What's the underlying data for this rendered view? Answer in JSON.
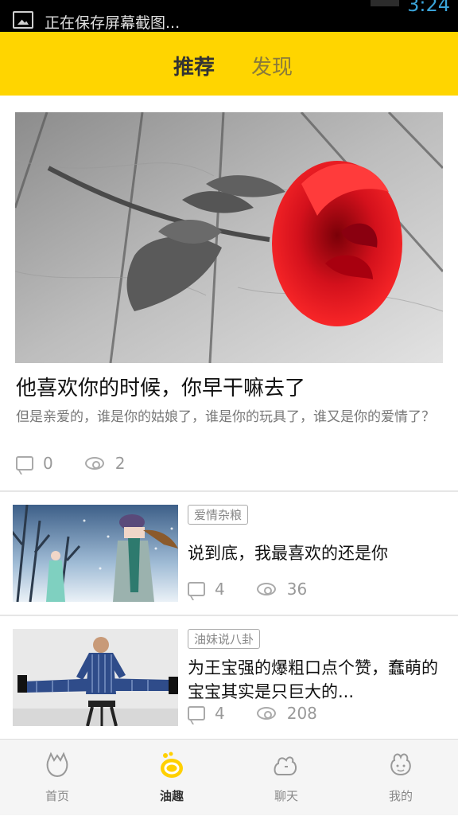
{
  "status_bar": {
    "notification_text": "正在保存屏幕截图...",
    "time": "3:24"
  },
  "header": {
    "tabs": [
      {
        "label": "推荐",
        "active": true
      },
      {
        "label": "发现",
        "active": false
      }
    ],
    "accent_color": "#ffd500"
  },
  "featured": {
    "image_icon": "red-rose-on-wood-photo",
    "title": "他喜欢你的时候，你早干嘛去了",
    "description": "但是亲爱的，谁是你的姑娘了，谁是你的玩具了，谁又是你的爱情了？",
    "comments": "0",
    "views": "2"
  },
  "articles": [
    {
      "image_icon": "winter-couple-illustration",
      "tag": "爱情杂粮",
      "title": "说到底，我最喜欢的还是你",
      "comments": "4",
      "views": "36"
    },
    {
      "image_icon": "man-doing-splits-photo",
      "tag": "油妹说八卦",
      "title": "为王宝强的爆粗口点个赞，蠢萌的宝宝其实是只巨大的...",
      "comments": "4",
      "views": "208"
    }
  ],
  "tabbar": [
    {
      "label": "首页",
      "icon": "home-icon",
      "active": false
    },
    {
      "label": "油趣",
      "icon": "youqu-icon",
      "active": true
    },
    {
      "label": "聊天",
      "icon": "chat-icon",
      "active": false
    },
    {
      "label": "我的",
      "icon": "profile-icon",
      "active": false
    }
  ]
}
